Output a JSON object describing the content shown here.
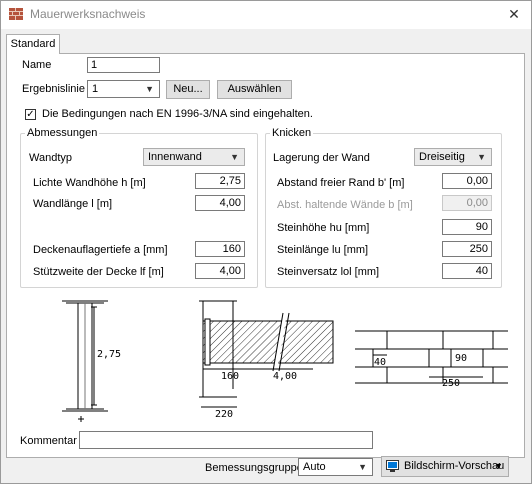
{
  "window": {
    "title": "Mauerwerksnachweis",
    "close_label": "✕"
  },
  "tabs": [
    {
      "label": "Standard"
    }
  ],
  "name": {
    "label": "Name",
    "value": "1"
  },
  "ergebnislinie": {
    "label": "Ergebnislinie",
    "value": "1",
    "new_label": "Neu...",
    "select_label": "Auswählen"
  },
  "conditions": {
    "checked": true,
    "label": "Die Bedingungen nach EN 1996-3/NA sind eingehalten."
  },
  "abmessungen": {
    "title": "Abmessungen",
    "wandtyp_label": "Wandtyp",
    "wandtyp_value": "Innenwand",
    "height_label": "Lichte Wandhöhe h [m]",
    "height_value": "2,75",
    "length_label": "Wandlänge l [m]",
    "length_value": "4,00",
    "auflager_label": "Deckenauflagertiefe a [mm]",
    "auflager_value": "160",
    "stuetz_label": "Stützweite der Decke lf [m]",
    "stuetz_value": "4,00"
  },
  "knicken": {
    "title": "Knicken",
    "lagerung_label": "Lagerung der Wand",
    "lagerung_value": "Dreiseitig",
    "abstand_label": "Abstand freier Rand b' [m]",
    "abstand_value": "0,00",
    "abst_label": "Abst. haltende Wände b [m]",
    "abst_value": "0,00",
    "hu_label": "Steinhöhe hu [mm]",
    "hu_value": "90",
    "lu_label": "Steinlänge lu [mm]",
    "lu_value": "250",
    "lol_label": "Steinversatz lol [mm]",
    "lol_value": "40"
  },
  "diagrams": {
    "section_height": "2,75",
    "plan_a": "160",
    "plan_lf": "4,00",
    "plan_wall": "220",
    "bond_hu": "90",
    "bond_lol": "40",
    "bond_lu": "250"
  },
  "kommentar": {
    "label": "Kommentar",
    "value": ""
  },
  "footer": {
    "bemessung_label": "Bemessungsgruppe",
    "bemessung_value": "Auto",
    "preview_label": "Bildschirm-Vorschau"
  },
  "colors": {
    "accent": "#0078d7",
    "brick": "#b5533c"
  }
}
